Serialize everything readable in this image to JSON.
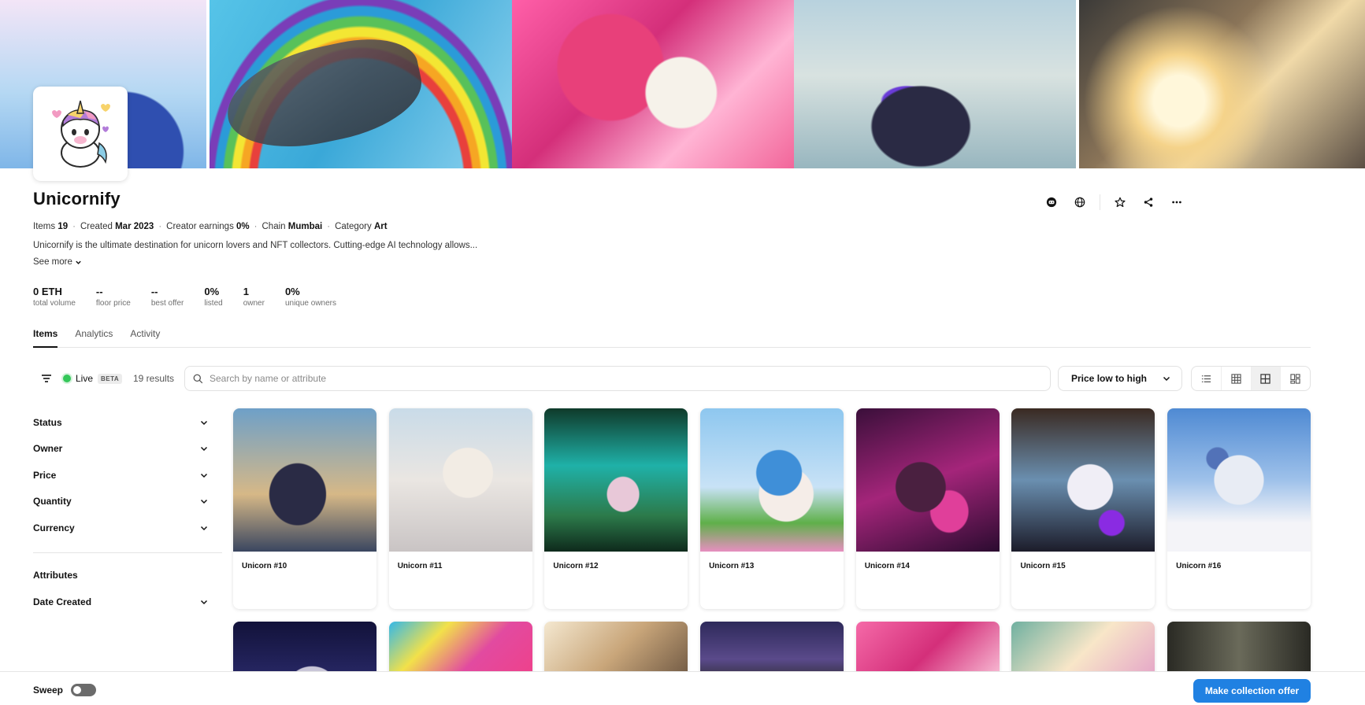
{
  "collection": {
    "name": "Unicornify",
    "meta": {
      "items_label": "Items",
      "items_value": "19",
      "created_label": "Created",
      "created_value": "Mar 2023",
      "earnings_label": "Creator earnings",
      "earnings_value": "0%",
      "chain_label": "Chain",
      "chain_value": "Mumbai",
      "category_label": "Category",
      "category_value": "Art",
      "separator": "·"
    },
    "description": "Unicornify is the ultimate destination for unicorn lovers and NFT collectors. Cutting-edge AI technology allows...",
    "see_more": "See more"
  },
  "header_icons": [
    "discord-icon",
    "website-icon",
    "star-icon",
    "share-icon",
    "more-icon"
  ],
  "stats": [
    {
      "value": "0 ETH",
      "label": "total volume"
    },
    {
      "value": "--",
      "label": "floor price"
    },
    {
      "value": "--",
      "label": "best offer"
    },
    {
      "value": "0%",
      "label": "listed"
    },
    {
      "value": "1",
      "label": "owner"
    },
    {
      "value": "0%",
      "label": "unique owners"
    }
  ],
  "tabs": [
    {
      "label": "Items",
      "active": true
    },
    {
      "label": "Analytics",
      "active": false
    },
    {
      "label": "Activity",
      "active": false
    }
  ],
  "toolbar": {
    "live_label": "Live",
    "beta_label": "BETA",
    "results": "19 results",
    "search_placeholder": "Search by name or attribute",
    "sort_value": "Price low to high",
    "view_modes": [
      "list-view-icon",
      "grid-small-icon",
      "grid-medium-icon",
      "grid-large-icon"
    ],
    "selected_view": 2
  },
  "filters": {
    "top": [
      "Status",
      "Owner",
      "Price",
      "Quantity",
      "Currency"
    ],
    "attributes": "Attributes",
    "date_created": "Date Created"
  },
  "items_row1": [
    "Unicorn #10",
    "Unicorn #11",
    "Unicorn #12",
    "Unicorn #13",
    "Unicorn #14",
    "Unicorn #15",
    "Unicorn #16"
  ],
  "bottom": {
    "sweep_label": "Sweep",
    "offer_button": "Make collection offer"
  },
  "colors": {
    "accent": "#2081e2",
    "live": "#34c759"
  }
}
